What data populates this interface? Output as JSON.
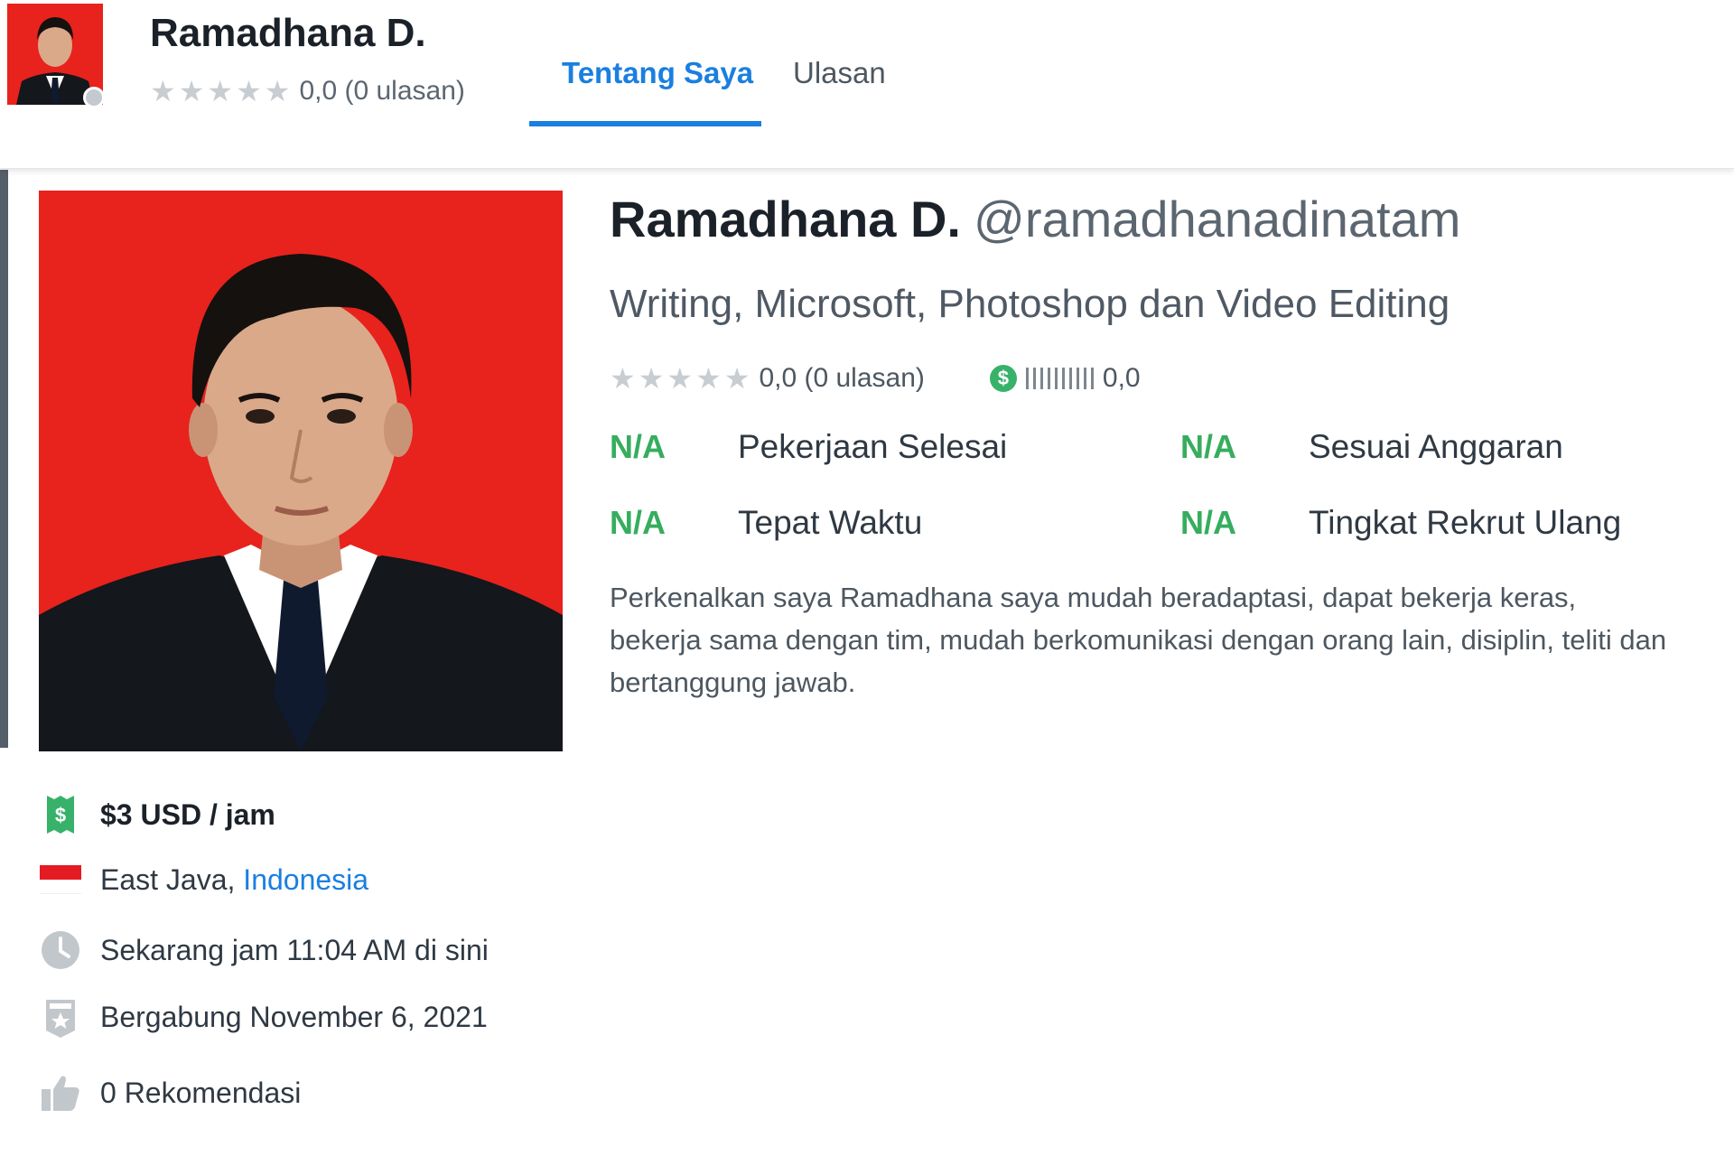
{
  "header": {
    "name": "Ramadhana D.",
    "rating_text": "0,0 (0 ulasan)",
    "rating_value": 0,
    "tabs": [
      {
        "label": "Tentang Saya",
        "active": true
      },
      {
        "label": "Ulasan",
        "active": false
      }
    ]
  },
  "profile": {
    "name": "Ramadhana D.",
    "handle": "@ramadhanadinatam",
    "tagline": "Writing, Microsoft, Photoshop dan Video Editing",
    "rating_text": "0,0 (0 ulasan)",
    "earnings_text": "0,0",
    "stats": [
      {
        "value": "N/A",
        "label": "Pekerjaan Selesai"
      },
      {
        "value": "N/A",
        "label": "Sesuai Anggaran"
      },
      {
        "value": "N/A",
        "label": "Tepat Waktu"
      },
      {
        "value": "N/A",
        "label": "Tingkat Rekrut Ulang"
      }
    ],
    "bio": "Perkenalkan saya Ramadhana saya mudah beradaptasi, dapat bekerja keras, bekerja sama dengan tim, mudah berkomunikasi dengan orang lain, disiplin, teliti dan bertanggung jawab."
  },
  "details": {
    "hourly_rate": "$3 USD / jam",
    "location_region": "East Java, ",
    "location_country": "Indonesia",
    "local_time": "Sekarang jam 11:04 AM di sini",
    "joined": "Bergabung November 6, 2021",
    "recommendations": "0 Rekomendasi"
  },
  "colors": {
    "accent": "#1a7fe0",
    "stat_green": "#36ad5e",
    "photo_background": "#e8221d",
    "star_empty": "#c8cdd2"
  },
  "icons": [
    "star-icon",
    "dollar-icon",
    "money-bill-icon",
    "flag-indonesia-icon",
    "clock-icon",
    "badge-icon",
    "thumbs-up-icon"
  ]
}
